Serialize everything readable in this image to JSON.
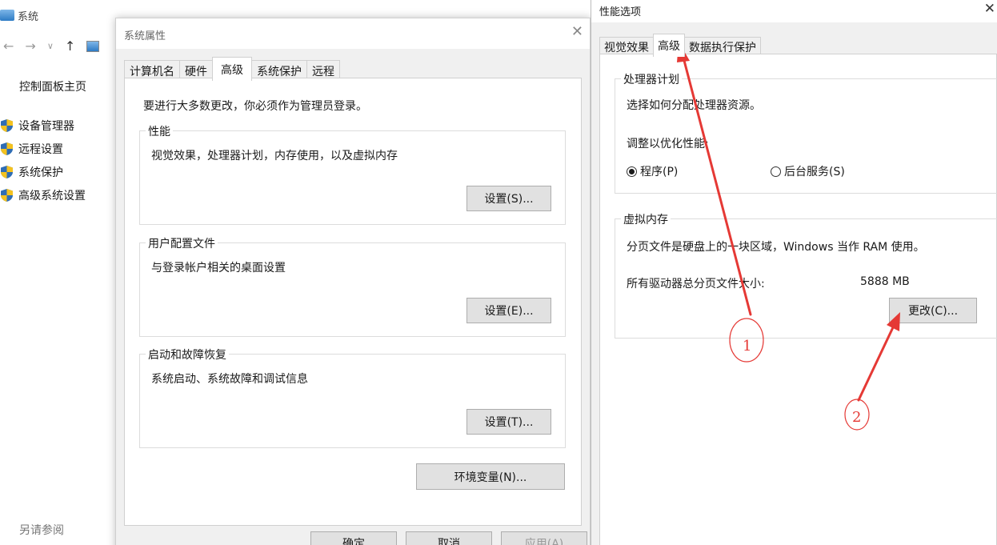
{
  "background_window": {
    "title": "系统",
    "control_panel_home": "控制面板主页",
    "links": [
      "设备管理器",
      "远程设置",
      "系统保护",
      "高级系统设置"
    ],
    "see_also": "另请参阅"
  },
  "system_properties": {
    "title": "系统属性",
    "tabs": [
      "计算机名",
      "硬件",
      "高级",
      "系统保护",
      "远程"
    ],
    "active_tab": "高级",
    "intro": "要进行大多数更改，你必须作为管理员登录。",
    "groups": [
      {
        "label": "性能",
        "desc": "视觉效果，处理器计划，内存使用，以及虚拟内存",
        "button": "设置(S)..."
      },
      {
        "label": "用户配置文件",
        "desc": "与登录帐户相关的桌面设置",
        "button": "设置(E)..."
      },
      {
        "label": "启动和故障恢复",
        "desc": "系统启动、系统故障和调试信息",
        "button": "设置(T)..."
      }
    ],
    "env_button": "环境变量(N)...",
    "footer": {
      "ok": "确定",
      "cancel": "取消",
      "apply": "应用(A)"
    }
  },
  "performance_options": {
    "title": "性能选项",
    "tabs": [
      "视觉效果",
      "高级",
      "数据执行保护"
    ],
    "active_tab": "高级",
    "processor": {
      "label": "处理器计划",
      "desc": "选择如何分配处理器资源。",
      "adjust": "调整以优化性能:",
      "options": [
        {
          "label": "程序(P)",
          "selected": true
        },
        {
          "label": "后台服务(S)",
          "selected": false
        }
      ]
    },
    "virtual_memory": {
      "label": "虚拟内存",
      "desc": "分页文件是硬盘上的一块区域，Windows 当作 RAM 使用。",
      "total_label": "所有驱动器总分页文件大小:",
      "total_value": "5888 MB",
      "change_button": "更改(C)..."
    }
  },
  "annotations": {
    "color": "#e53935",
    "marker_1": "1",
    "marker_2": "2"
  }
}
